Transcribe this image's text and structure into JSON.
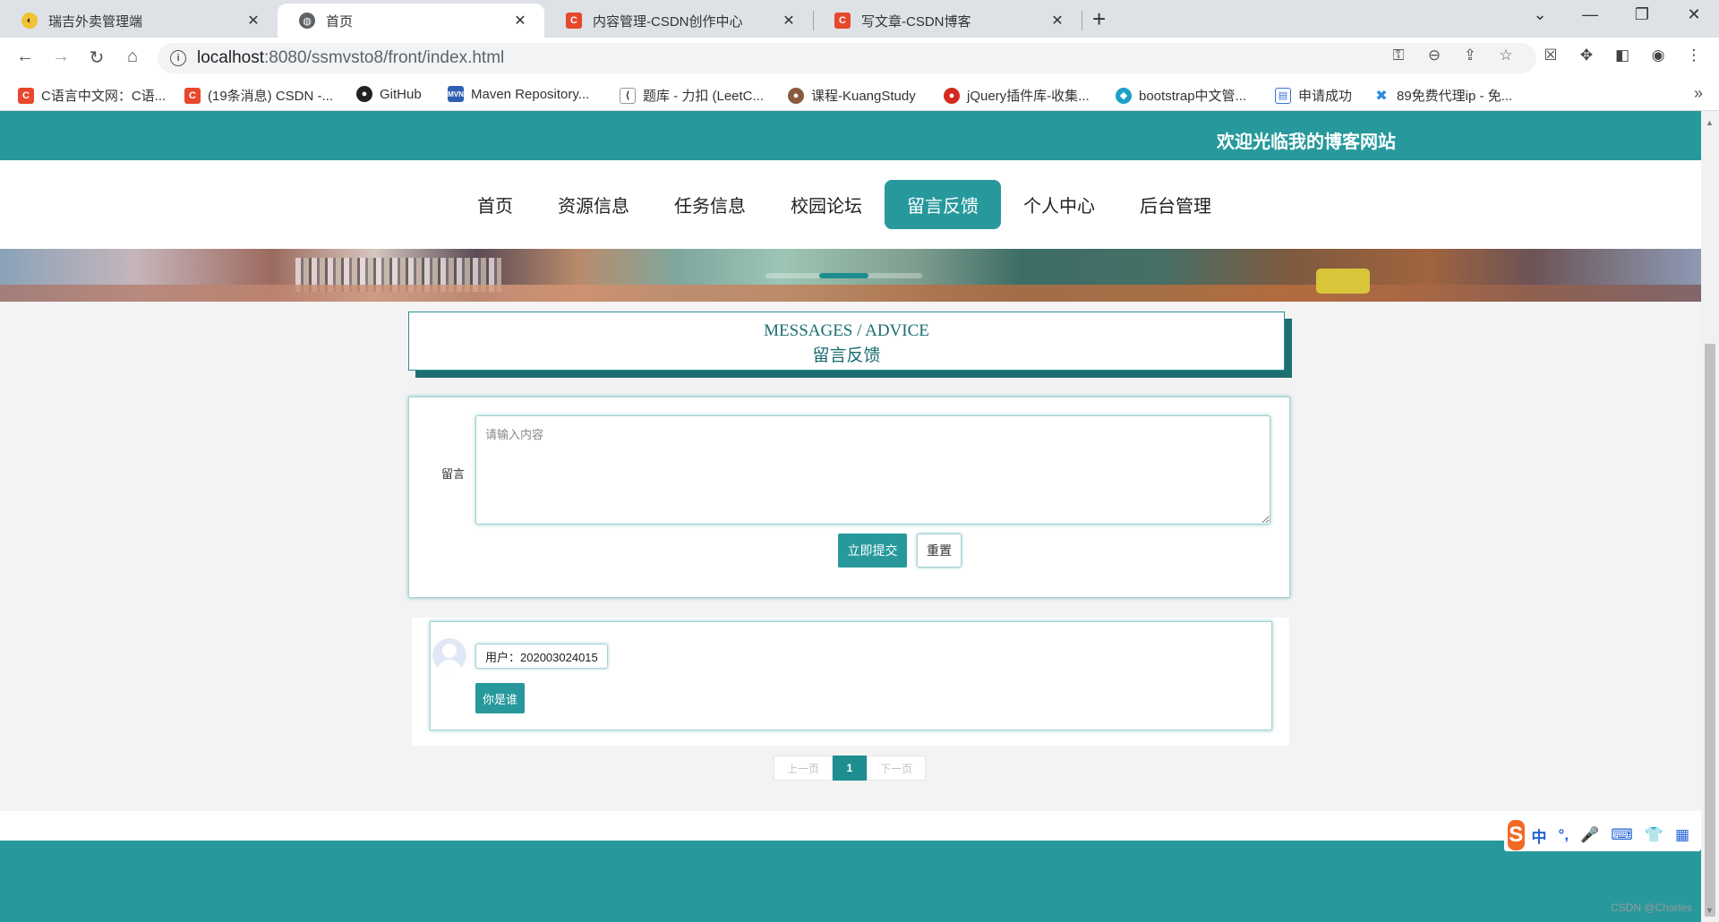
{
  "browser": {
    "tabs": [
      {
        "title": "瑞吉外卖管理端",
        "active": false
      },
      {
        "title": "首页",
        "active": true
      },
      {
        "title": "内容管理-CSDN创作中心",
        "active": false
      },
      {
        "title": "写文章-CSDN博客",
        "active": false
      }
    ],
    "close_glyph": "✕",
    "new_tab_glyph": "+",
    "url_host": "localhost",
    "url_path": ":8080/ssmvsto8/front/index.html",
    "bookmarks": [
      "C语言中文网：C语...",
      "(19条消息) CSDN -...",
      "GitHub",
      "Maven Repository...",
      "题库 - 力扣 (LeetC...",
      "课程-KuangStudy",
      "jQuery插件库-收集...",
      "bootstrap中文管...",
      "申请成功",
      "89免费代理ip - 免..."
    ],
    "colors": {
      "accent": "#27999c",
      "csdn_red": "#e7472b"
    }
  },
  "site": {
    "welcome": "欢迎光临我的博客网站",
    "nav": [
      {
        "label": "首页",
        "active": false
      },
      {
        "label": "资源信息",
        "active": false
      },
      {
        "label": "任务信息",
        "active": false
      },
      {
        "label": "校园论坛",
        "active": false
      },
      {
        "label": "留言反馈",
        "active": true
      },
      {
        "label": "个人中心",
        "active": false
      },
      {
        "label": "后台管理",
        "active": false
      }
    ],
    "section_title_en": "MESSAGES / ADVICE",
    "section_title_zh": "留言反馈",
    "form": {
      "label": "留言",
      "placeholder": "请输入内容",
      "submit": "立即提交",
      "reset": "重置"
    },
    "messages": [
      {
        "user": "用户：202003024015",
        "content": "你是谁"
      }
    ],
    "pager": {
      "prev": "上一页",
      "current": "1",
      "next": "下一页"
    }
  },
  "ime": {
    "items": [
      "中",
      "°,",
      "🎤",
      "⌨",
      "👕",
      "▦"
    ]
  },
  "watermark": "CSDN @Charles"
}
